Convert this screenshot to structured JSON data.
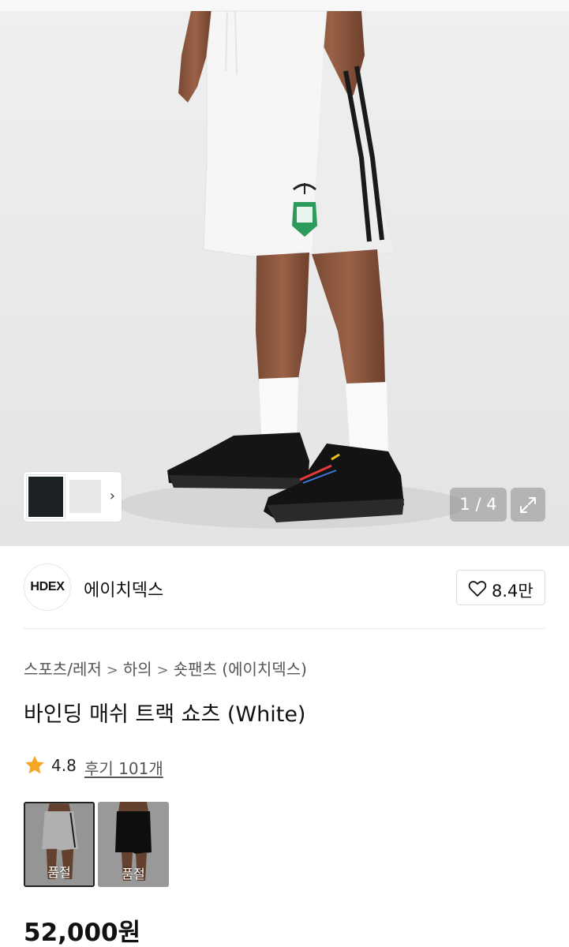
{
  "gallery": {
    "pager": "1 / 4",
    "thumbnail_next_icon": "chevron-right-icon",
    "expand_icon": "expand-icon"
  },
  "brand": {
    "logo_text": "HDEX",
    "name": "에이치덱스",
    "like_icon": "heart-icon",
    "like_count": "8.4만"
  },
  "breadcrumb": {
    "items": [
      "스포츠/레저",
      "하의",
      "숏팬츠 (에이치덱스)"
    ],
    "separator": ">"
  },
  "product": {
    "title": "바인딩 매쉬 트랙 쇼츠 (White)",
    "rating": "4.8",
    "reviews_label": "후기 101개",
    "price": "52,000원"
  },
  "color_options": [
    {
      "label": "품절",
      "selected": true
    },
    {
      "label": "품절",
      "selected": false
    }
  ],
  "colors": {
    "star": "#f5a623",
    "pager_bg": "#8a8a8a",
    "text_primary": "#111111",
    "text_secondary": "#555555"
  }
}
